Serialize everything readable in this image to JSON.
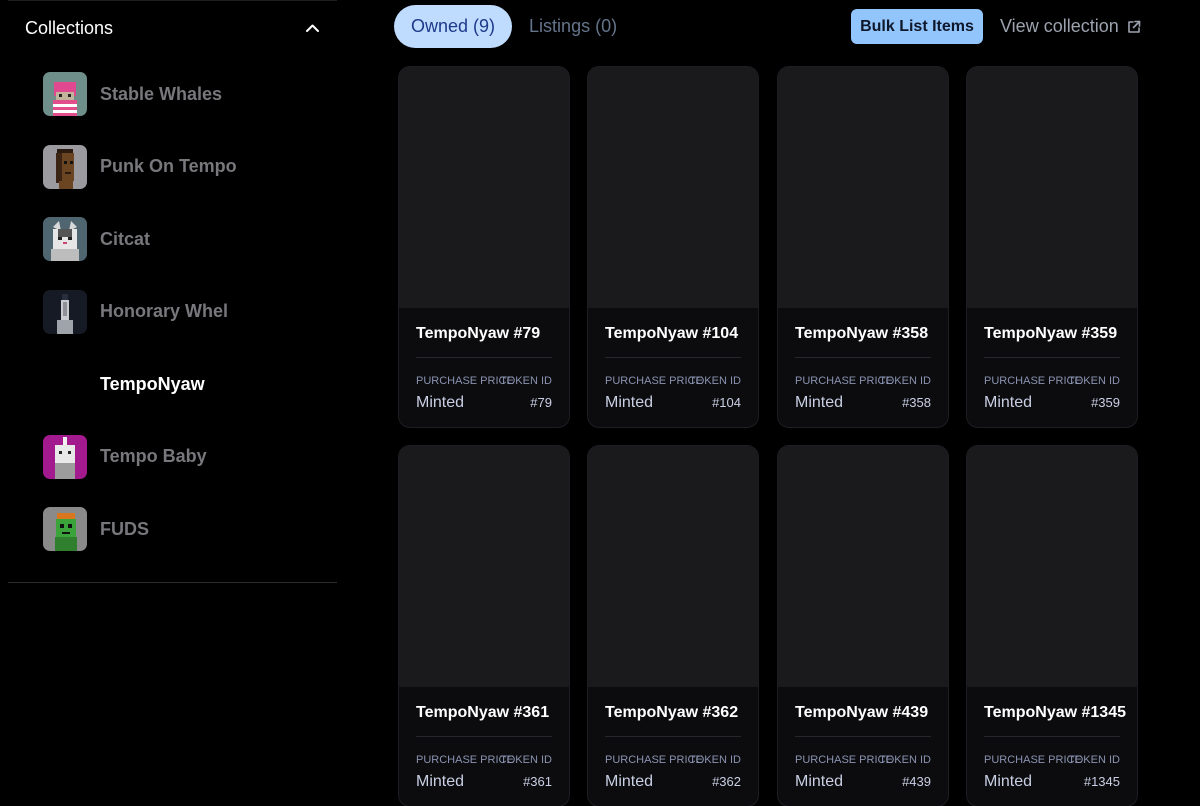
{
  "sidebar": {
    "title": "Collections",
    "collections": [
      {
        "name": "Stable Whales",
        "active": false
      },
      {
        "name": "Punk On Tempo",
        "active": false
      },
      {
        "name": "Citcat",
        "active": false
      },
      {
        "name": "Honorary Whel",
        "active": false
      },
      {
        "name": "TempoNyaw",
        "active": true
      },
      {
        "name": "Tempo Baby",
        "active": false
      },
      {
        "name": "FUDS",
        "active": false
      }
    ]
  },
  "toolbar": {
    "tab_owned": "Owned (9)",
    "tab_listings": "Listings (0)",
    "bulk_list_label": "Bulk List Items",
    "view_collection_label": "View collection"
  },
  "card_labels": {
    "purchase_price": "PURCHASE PRICE",
    "token_id": "TOKEN ID"
  },
  "items": [
    {
      "name": "TempoNyaw #79",
      "price": "Minted",
      "token_id": "#79"
    },
    {
      "name": "TempoNyaw #104",
      "price": "Minted",
      "token_id": "#104"
    },
    {
      "name": "TempoNyaw #358",
      "price": "Minted",
      "token_id": "#358"
    },
    {
      "name": "TempoNyaw #359",
      "price": "Minted",
      "token_id": "#359"
    },
    {
      "name": "TempoNyaw #361",
      "price": "Minted",
      "token_id": "#361"
    },
    {
      "name": "TempoNyaw #362",
      "price": "Minted",
      "token_id": "#362"
    },
    {
      "name": "TempoNyaw #439",
      "price": "Minted",
      "token_id": "#439"
    },
    {
      "name": "TempoNyaw #1345",
      "price": "Minted",
      "token_id": "#1345"
    }
  ],
  "colors": {
    "background": "#000000",
    "active_tab_bg": "#bfdbfe",
    "bulk_button_bg": "#93c5fd",
    "card_image_bg": "#1a1a1d"
  }
}
